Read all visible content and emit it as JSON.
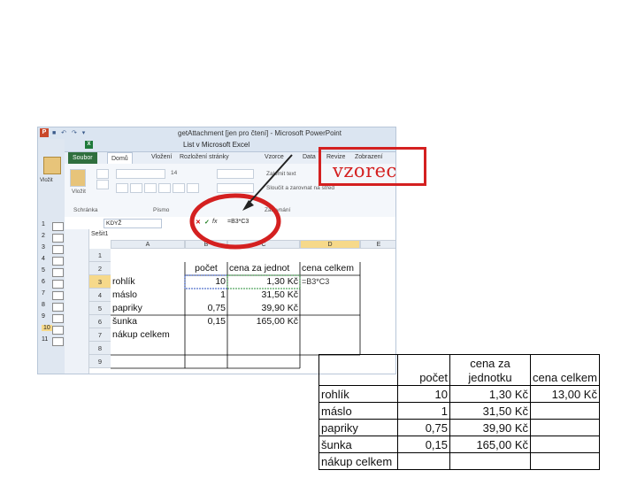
{
  "powerpoint": {
    "title": "getAttachment [jen pro čtení] - Microsoft PowerPoint",
    "paste_label": "Vložit",
    "slide_numbers": [
      "1",
      "2",
      "3",
      "4",
      "5",
      "6",
      "7",
      "8",
      "9",
      "10",
      "11"
    ]
  },
  "excel": {
    "title": "List v Microsoft Excel",
    "tabs": [
      "Soubor",
      "Domů",
      "Vložení",
      "Rozložení stránky",
      "Vzorce",
      "Data",
      "Revize",
      "Zobrazení"
    ],
    "ribbon": {
      "group_clipboard": "Schránka",
      "group_font": "Písmo",
      "group_alignment": "Zarovnání",
      "paste": "Vložit",
      "wrap_text": "Zalomit text",
      "merge": "Sloučit a zarovnat na střed",
      "font_size": "14"
    },
    "name_box": "KDYŽ",
    "formula": "=B3*C3",
    "sheet_name": "Sešit1",
    "columns": [
      "A",
      "B",
      "C",
      "D",
      "E"
    ],
    "rows": [
      "1",
      "2",
      "3",
      "4",
      "5",
      "6",
      "7",
      "8",
      "9"
    ],
    "cells": {
      "b2": "počet",
      "c2": "cena za jednot",
      "d2": "cena celkem",
      "a3": "rohlík",
      "b3": "10",
      "c3": "1,30 Kč",
      "d3": "=B3*C3",
      "a4": "máslo",
      "b4": "1",
      "c4": "31,50 Kč",
      "a5": "papriky",
      "b5": "0,75",
      "c5": "39,90 Kč",
      "a6": "šunka",
      "b6": "0,15",
      "c6": "165,00 Kč",
      "a7": "nákup celkem"
    }
  },
  "annotation": {
    "label": "vzorec",
    "color": "#d42020"
  },
  "result_table": {
    "headers": [
      "",
      "počet",
      "cena za\njednotku",
      "cena celkem"
    ],
    "rows": [
      [
        "rohlík",
        "10",
        "1,30 Kč",
        "13,00 Kč"
      ],
      [
        "máslo",
        "1",
        "31,50 Kč",
        ""
      ],
      [
        "papriky",
        "0,75",
        "39,90 Kč",
        ""
      ],
      [
        "šunka",
        "0,15",
        "165,00 Kč",
        ""
      ],
      [
        "nákup celkem",
        "",
        "",
        ""
      ]
    ]
  }
}
